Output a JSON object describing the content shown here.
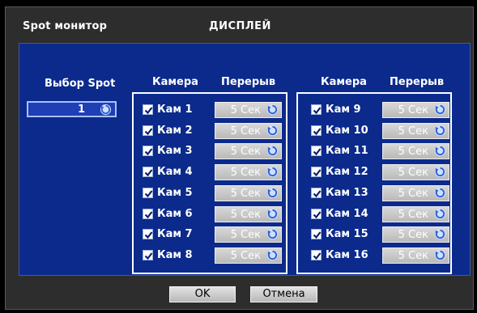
{
  "header": {
    "app_title": "Spot монитор",
    "window_title": "ДИСПЛЕЙ"
  },
  "spot": {
    "label": "Выбор Spot",
    "value": "1"
  },
  "columns": {
    "camera": "Камера",
    "interval": "Перерыв"
  },
  "cameras": [
    {
      "label": "Кам 1",
      "interval": "5 Сек",
      "checked": true
    },
    {
      "label": "Кам 2",
      "interval": "5 Сек",
      "checked": true
    },
    {
      "label": "Кам 3",
      "interval": "5 Сек",
      "checked": true
    },
    {
      "label": "Кам 4",
      "interval": "5 Сек",
      "checked": true
    },
    {
      "label": "Кам 5",
      "interval": "5 Сек",
      "checked": true
    },
    {
      "label": "Кам 6",
      "interval": "5 Сек",
      "checked": true
    },
    {
      "label": "Кам 7",
      "interval": "5 Сек",
      "checked": true
    },
    {
      "label": "Кам 8",
      "interval": "5 Сек",
      "checked": true
    },
    {
      "label": "Кам 9",
      "interval": "5 Сек",
      "checked": true
    },
    {
      "label": "Кам 10",
      "interval": "5 Сек",
      "checked": true
    },
    {
      "label": "Кам 11",
      "interval": "5 Сек",
      "checked": true
    },
    {
      "label": "Кам 12",
      "interval": "5 Сек",
      "checked": true
    },
    {
      "label": "Кам 13",
      "interval": "5 Сек",
      "checked": true
    },
    {
      "label": "Кам 14",
      "interval": "5 Сек",
      "checked": true
    },
    {
      "label": "Кам 15",
      "interval": "5 Сек",
      "checked": true
    },
    {
      "label": "Кам 16",
      "interval": "5 Сек",
      "checked": true
    }
  ],
  "buttons": {
    "ok": "OK",
    "cancel": "Отмена"
  },
  "colors": {
    "panel": "#0b2a8c",
    "background": "#2d2d2d",
    "accent": "#1f3fb5"
  },
  "icons": {
    "spinner": "refresh-spin-icon",
    "check": "check-icon"
  }
}
